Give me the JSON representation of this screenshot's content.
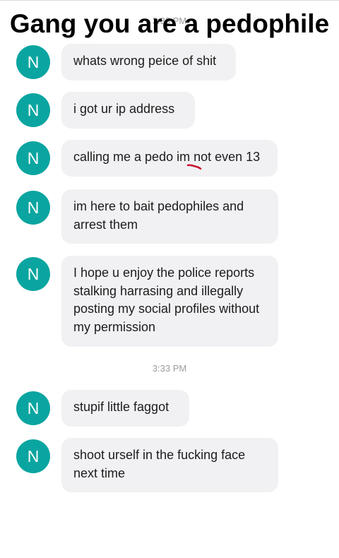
{
  "caption": {
    "line1": "Gang you are a pedophile",
    "line2": "???"
  },
  "timestamps": [
    "3:33 PM",
    "3:33 PM"
  ],
  "avatar_letter": "N",
  "accent_color": "#0aa5a0",
  "messages": [
    {
      "text": "whats wrong peice of shit"
    },
    {
      "text": "i got ur ip address"
    },
    {
      "text": "calling me a pedo im not even 13"
    },
    {
      "text": "im here to bait pedophiles and arrest them"
    },
    {
      "text": "I hope u enjoy the police reports stalking harrasing and illegally posting my social profiles without my permission"
    },
    {
      "text": "stupif little faggot"
    },
    {
      "text": "shoot urself in the fucking face next time"
    }
  ]
}
